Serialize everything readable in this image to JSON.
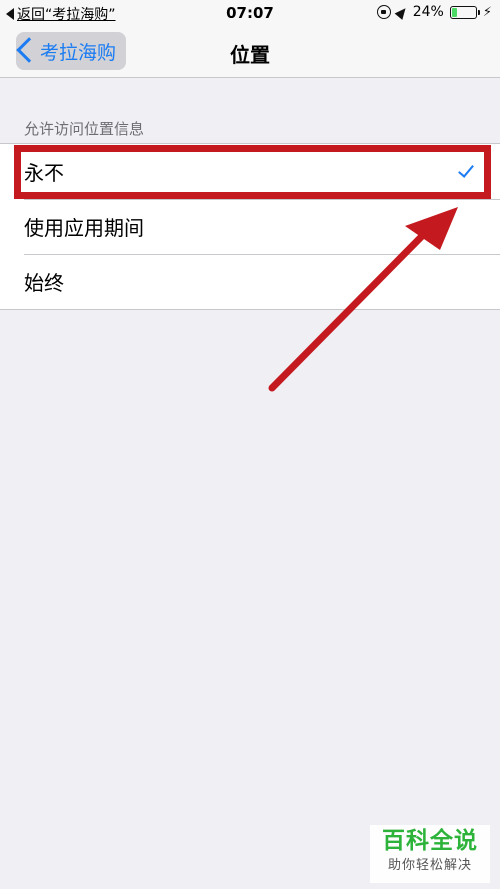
{
  "status_bar": {
    "back_text": "返回“考拉海购”",
    "time": "07:07",
    "battery": "24%",
    "battery_level": 0.24
  },
  "nav": {
    "back_label": "考拉海购",
    "title": "位置"
  },
  "section": {
    "header": "允许访问位置信息",
    "options": [
      {
        "label": "永不",
        "selected": true
      },
      {
        "label": "使用应用期间",
        "selected": false
      },
      {
        "label": "始终",
        "selected": false
      }
    ]
  },
  "colors": {
    "accent": "#1c7cf2",
    "annotation": "#c4191e",
    "background": "#efeff4"
  },
  "watermark": {
    "title": "百科全说",
    "subtitle": "助你轻松解决"
  }
}
